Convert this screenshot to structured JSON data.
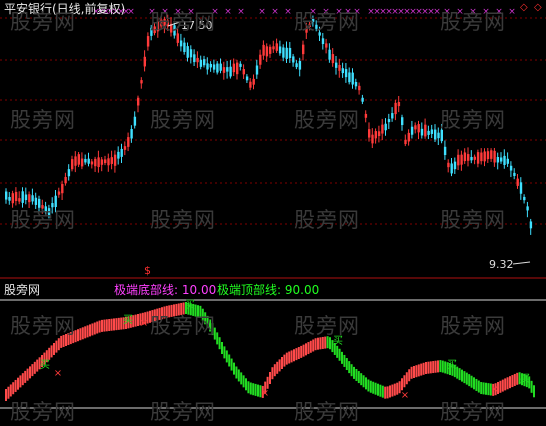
{
  "header": {
    "stock_title": "平安银行(日线,前复权)",
    "indicator_source": "股旁网",
    "line_bottom_label": "极端底部线: 10.00",
    "line_top_label": "极端顶部线: 90.00"
  },
  "watermark": "股旁网",
  "price_panel": {
    "high_label": "17.50",
    "low_label": "9.32",
    "dollar_marker": "$"
  },
  "signals": {
    "buy_text": "买",
    "sell_text": "卖"
  },
  "colors": {
    "background": "#000000",
    "up_candle": "#ff3a3a",
    "down_candle": "#3fe0ff",
    "grid": "#800000",
    "osc_up": "#ff4a4a",
    "osc_down": "#22dd22",
    "bottom_label": "#ff40ff",
    "top_label": "#20ff20",
    "x_marks": "#cc33cc"
  }
}
